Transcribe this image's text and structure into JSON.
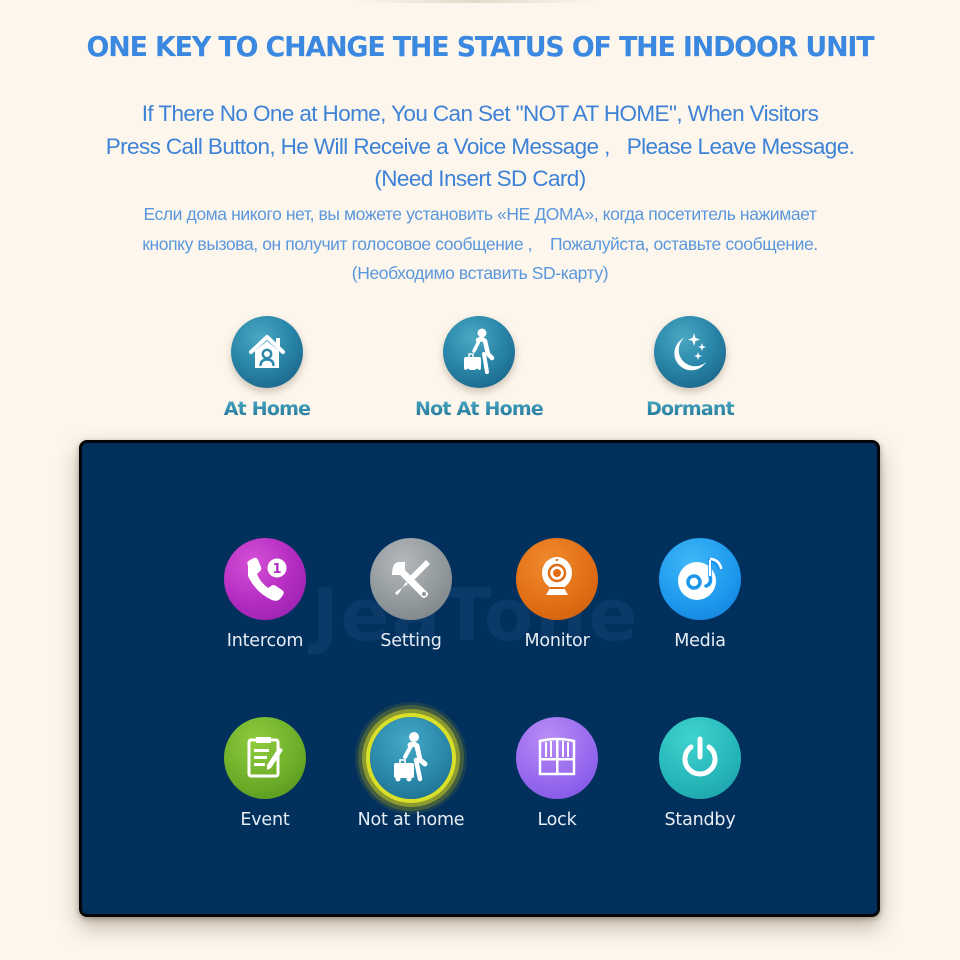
{
  "header": {
    "title": "ONE KEY TO CHANGE THE STATUS OF THE INDOOR UNIT"
  },
  "description_en": {
    "lines": [
      "If There No One at Home, You Can Set \"NOT AT HOME\", When Visitors",
      "Press Call Button, He Will Receive a Voice Message ,   Please Leave Message.",
      "(Need Insert SD Card)"
    ]
  },
  "description_ru": {
    "lines": [
      "Если дома никого нет, вы можете установить «НЕ ДОМА», когда посетитель нажимает",
      "кнопку вызова, он получит голосовое сообщение ,    Пожалуйста, оставьте сообщение.",
      "(Необходимо вставить SD-карту)"
    ]
  },
  "modes": [
    {
      "label": "At Home",
      "icon": "home-person-icon"
    },
    {
      "label": "Not At Home",
      "icon": "person-luggage-icon"
    },
    {
      "label": "Dormant",
      "icon": "moon-stars-icon"
    }
  ],
  "screen": {
    "watermark": "JeaTone",
    "apps": [
      {
        "label": "Intercom",
        "icon": "phone-call-icon",
        "badge": "1",
        "color": "#b22bc1"
      },
      {
        "label": "Setting",
        "icon": "tools-icon",
        "color": "#8e9598"
      },
      {
        "label": "Monitor",
        "icon": "webcam-icon",
        "color": "#e06d14"
      },
      {
        "label": "Media",
        "icon": "music-disc-icon",
        "color": "#1c97ec"
      },
      {
        "label": "Event",
        "icon": "clipboard-pen-icon",
        "color": "#6aab27"
      },
      {
        "label": "Not at home",
        "icon": "person-luggage-icon",
        "color": "#2a87a8",
        "selected": true,
        "highlight_color": "#d8e02a"
      },
      {
        "label": "Lock",
        "icon": "gate-icon",
        "color": "#9467ee"
      },
      {
        "label": "Standby",
        "icon": "power-icon",
        "color": "#25b6b8"
      }
    ]
  },
  "colors": {
    "background": "#fdf6ec",
    "title": "#3a88e0",
    "screen": "#02305d",
    "mode_circle": "#2a87a9"
  }
}
